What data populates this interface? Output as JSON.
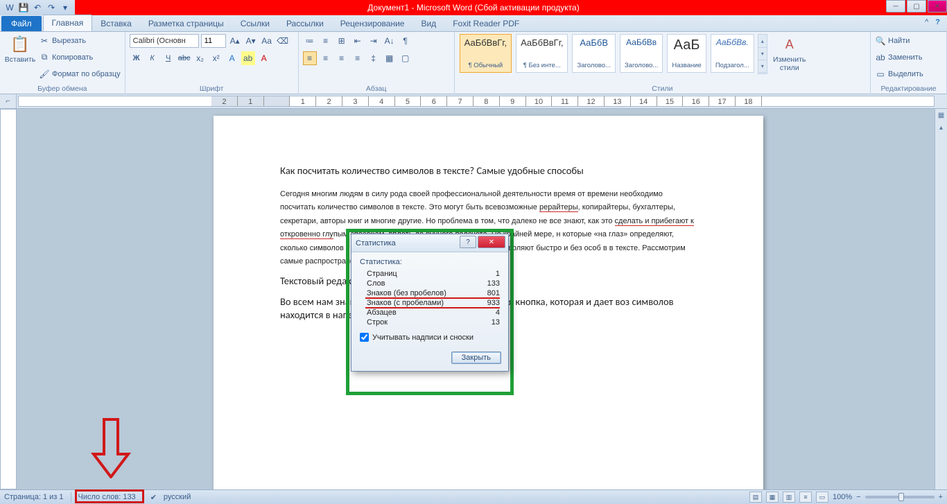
{
  "titlebar": {
    "title": "Документ1 - Microsoft Word (Сбой активации продукта)"
  },
  "tabs": {
    "file": "Файл",
    "home": "Главная",
    "insert": "Вставка",
    "layout": "Разметка страницы",
    "refs": "Ссылки",
    "mail": "Рассылки",
    "review": "Рецензирование",
    "view": "Вид",
    "foxit": "Foxit Reader PDF"
  },
  "clipboard": {
    "paste": "Вставить",
    "cut": "Вырезать",
    "copy": "Копировать",
    "fmt": "Формат по образцу",
    "group": "Буфер обмена"
  },
  "font": {
    "name": "Calibri (Основн",
    "size": "11",
    "group": "Шрифт"
  },
  "para": {
    "group": "Абзац"
  },
  "styles": {
    "group": "Стили",
    "change": "Изменить\nстили",
    "s1": "АаБбВвГг,",
    "s1n": "¶ Обычный",
    "s2": "АаБбВвГг,",
    "s2n": "¶ Без инте...",
    "s3": "АаБбВ",
    "s3n": "Заголово...",
    "s4": "АаБбВв",
    "s4n": "Заголово...",
    "s5": "АаБ",
    "s5n": "Название",
    "s6": "АаБбВв.",
    "s6n": "Подзагол..."
  },
  "editing": {
    "find": "Найти",
    "replace": "Заменить",
    "select": "Выделить",
    "group": "Редактирование"
  },
  "doc": {
    "title": "Как посчитать количество символов в тексте? Самые удобные способы",
    "p1a": "Сегодня многим людям в силу рода своей профессиональной деятельности время от времени необходимо посчитать количество символов в тексте. Это могут быть всевозможные ",
    "p1b": "рерайтеры",
    "p1c": ", копирайтеры, бухгалтеры, секретари, авторы книг и многие другие. Но проблема в том, что далеко не все знают, как это ",
    "p1d": "сделать и прибегают к откровенно глу",
    "p1e": "пым способам, вплоть до ручного подсчета. По крайней мере, н",
    "p1f": "                                                          которые «на глаз» определяют, сколько символов у них в те                                                          ень простых способов, которые позволяют быстро и без особ                                                          в в тексте. Рассмотрим самые распространенные и",
    "p2": "Текстовый редакто",
    "p3": "Во всем нам знако                                                          Word есть очень простая и удобная кнопка, которая и дает воз                                                          символов находится в напечатанном тексте."
  },
  "dialog": {
    "title": "Статистика",
    "header": "Статистика:",
    "r1": "Страниц",
    "v1": "1",
    "r2": "Слов",
    "v2": "133",
    "r3": "Знаков (без пробелов)",
    "v3": "801",
    "r4": "Знаков (с пробелами)",
    "v4": "933",
    "r5": "Абзацев",
    "v5": "4",
    "r6": "Строк",
    "v6": "13",
    "chk": "Учитывать надписи и сноски",
    "close": "Закрыть"
  },
  "status": {
    "page": "Страница: 1 из 1",
    "words": "Число слов: 133",
    "lang": "русский",
    "zoom": "100%"
  },
  "ruler": [
    "2",
    "1",
    "",
    "1",
    "2",
    "3",
    "4",
    "5",
    "6",
    "7",
    "8",
    "9",
    "10",
    "11",
    "12",
    "13",
    "14",
    "15",
    "16",
    "17",
    "18"
  ]
}
